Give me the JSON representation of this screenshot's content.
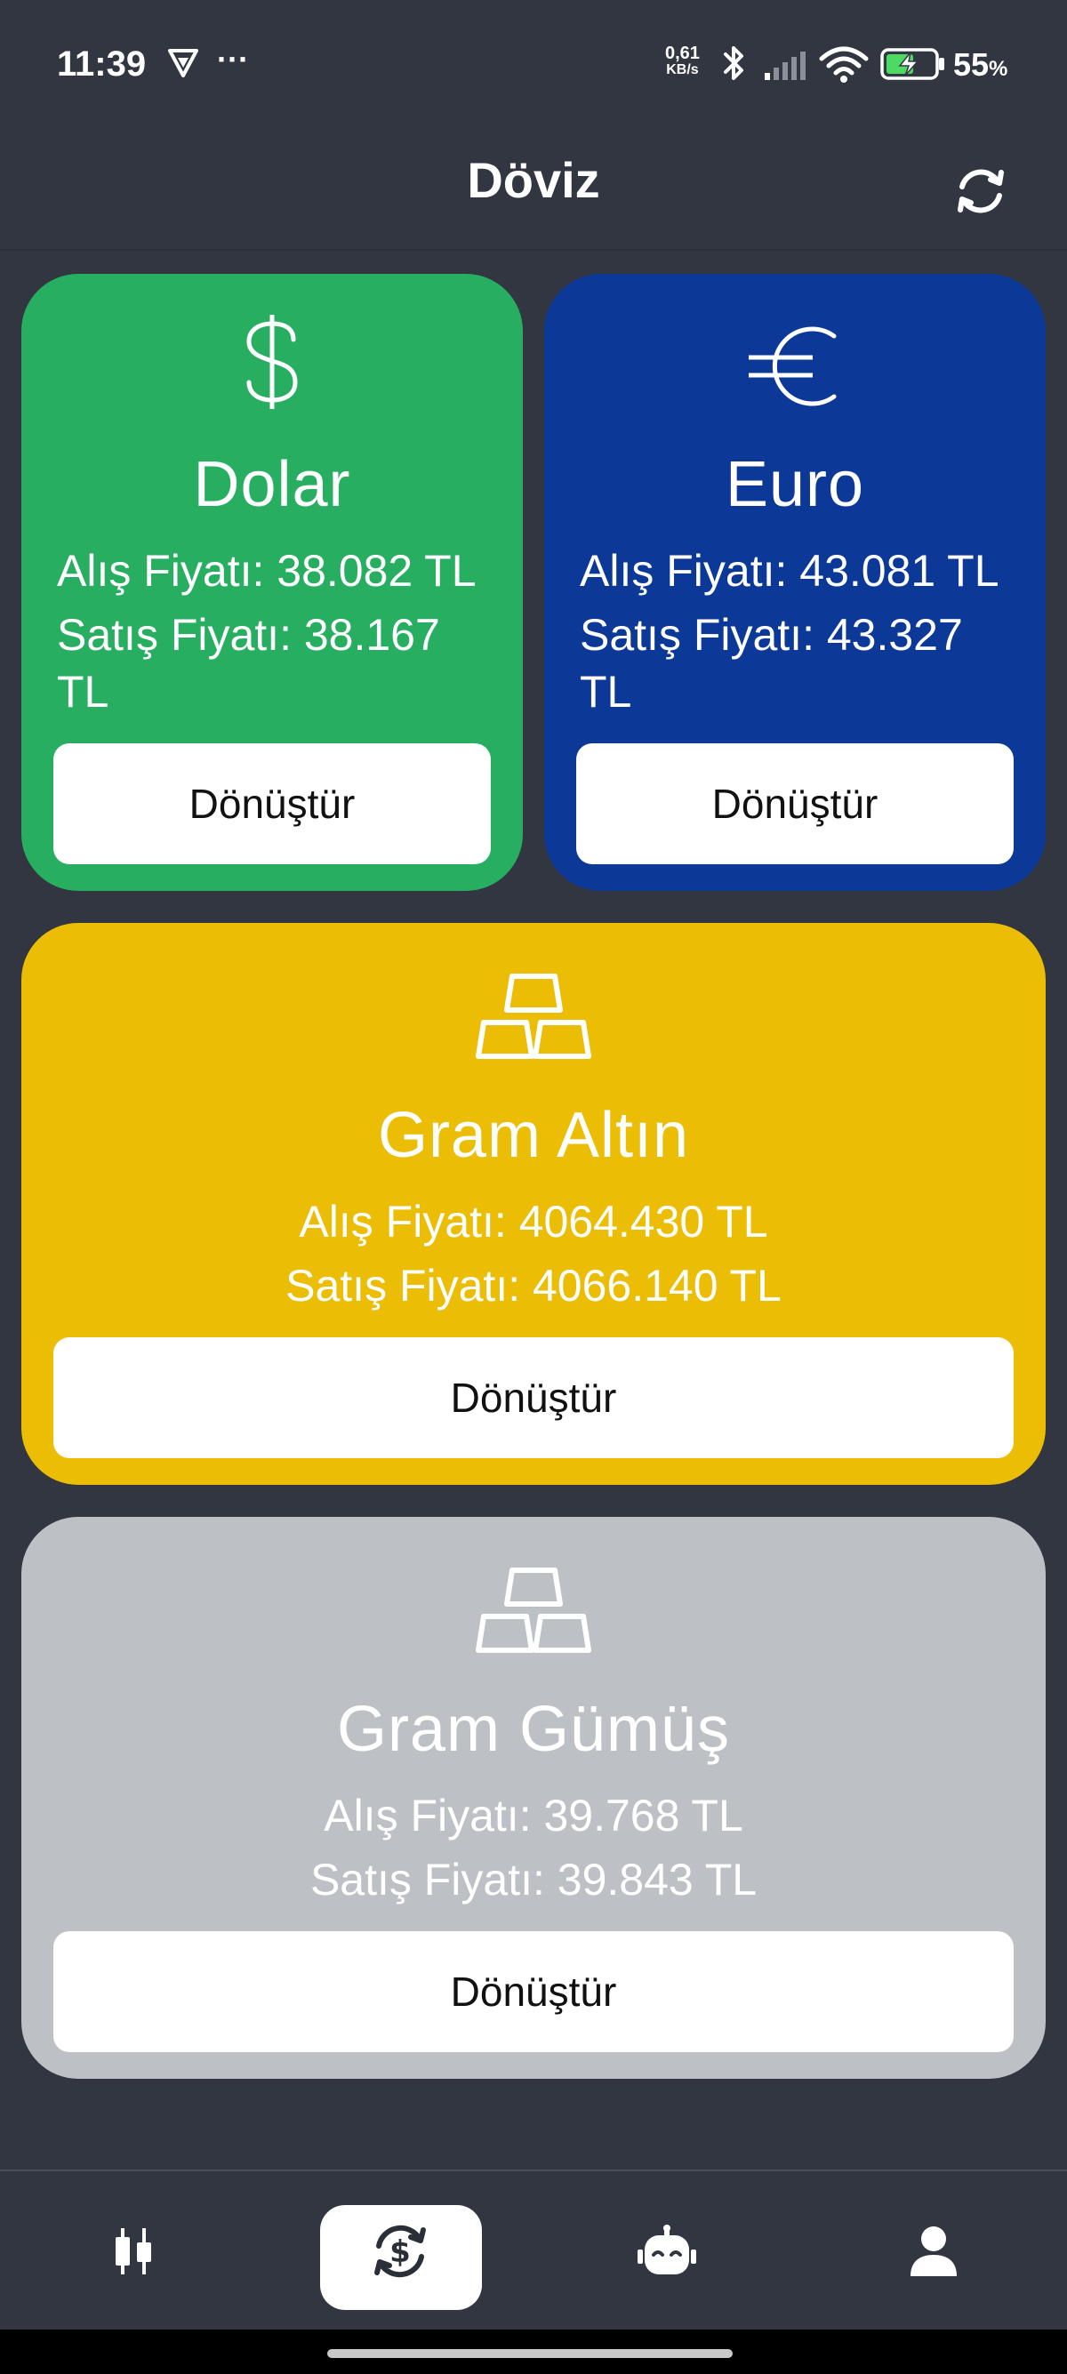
{
  "status_bar": {
    "time": "11:39",
    "overflow": "···",
    "net_speed_value": "0,61",
    "net_speed_unit": "KB/s",
    "battery_percent": "55",
    "battery_suffix": "%",
    "icons": [
      "vpn-icon",
      "bluetooth-icon",
      "signal-icon",
      "wifi-icon",
      "battery-charging-icon"
    ]
  },
  "header": {
    "title": "Döviz",
    "refresh_icon": "refresh-icon"
  },
  "cards": {
    "dolar": {
      "icon": "dollar-icon",
      "name": "Dolar",
      "buy": "Alış Fiyatı: 38.082 TL",
      "sell_line1": "Satış Fiyatı: 38.167",
      "sell_line2": "TL",
      "button": "Dönüştür",
      "color": "#27ae60"
    },
    "euro": {
      "icon": "euro-icon",
      "name": "Euro",
      "buy": "Alış Fiyatı: 43.081 TL",
      "sell_line1": "Satış Fiyatı: 43.327",
      "sell_line2": "TL",
      "button": "Dönüştür",
      "color": "#0c3898"
    },
    "altin": {
      "icon": "gold-bars-icon",
      "name": "Gram Altın",
      "buy": "Alış Fiyatı: 4064.430 TL",
      "sell": "Satış Fiyatı: 4066.140 TL",
      "button": "Dönüştür",
      "color": "#ebbe05"
    },
    "gumus": {
      "icon": "silver-bars-icon",
      "name": "Gram Gümüş",
      "buy": "Alış Fiyatı: 39.768 TL",
      "sell": "Satış Fiyatı: 39.843 TL",
      "button": "Dönüştür",
      "color": "#bdc1c5"
    }
  },
  "bottom_nav": {
    "items": [
      {
        "icon": "candlestick-chart-icon",
        "active": false
      },
      {
        "icon": "currency-exchange-icon",
        "active": true
      },
      {
        "icon": "robot-icon",
        "active": false
      },
      {
        "icon": "user-icon",
        "active": false
      }
    ]
  }
}
